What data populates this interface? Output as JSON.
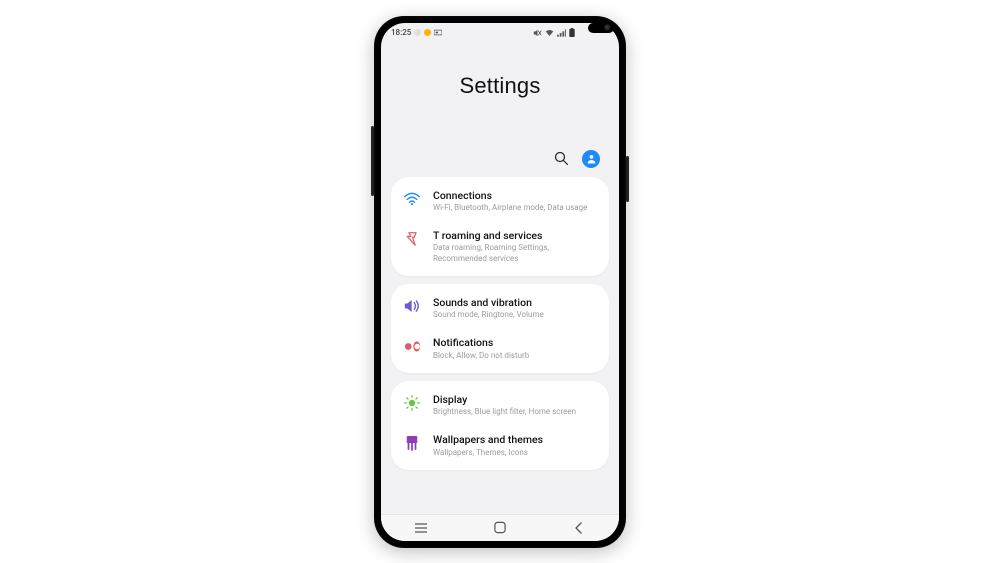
{
  "statusbar": {
    "time": "18:25",
    "indicator_colors": [
      "#e0e0e0",
      "#ffb300",
      "#9e9e9e"
    ]
  },
  "header": {
    "title": "Settings"
  },
  "colors": {
    "accent_blue": "#1e88ff",
    "wifi": "#1e88ff",
    "roaming": "#e35b63",
    "sound": "#6b5bd8",
    "notif": "#e35b63",
    "display": "#6ac24a",
    "wallpaper": "#8a3fb5"
  },
  "groups": [
    {
      "items": [
        {
          "icon": "wifi-icon",
          "color_key": "wifi",
          "title": "Connections",
          "sub": "Wi-Fi, Bluetooth, Airplane mode, Data usage"
        },
        {
          "icon": "roaming-icon",
          "color_key": "roaming",
          "title": "T roaming and services",
          "sub": "Data roaming, Roaming Settings, Recommended services"
        }
      ]
    },
    {
      "items": [
        {
          "icon": "sound-icon",
          "color_key": "sound",
          "title": "Sounds and vibration",
          "sub": "Sound mode, Ringtone, Volume"
        },
        {
          "icon": "notification-icon",
          "color_key": "notif",
          "title": "Notifications",
          "sub": "Block, Allow, Do not disturb"
        }
      ]
    },
    {
      "items": [
        {
          "icon": "display-icon",
          "color_key": "display",
          "title": "Display",
          "sub": "Brightness, Blue light filter, Home screen"
        },
        {
          "icon": "wallpaper-icon",
          "color_key": "wallpaper",
          "title": "Wallpapers and themes",
          "sub": "Wallpapers, Themes, Icons"
        }
      ]
    }
  ]
}
